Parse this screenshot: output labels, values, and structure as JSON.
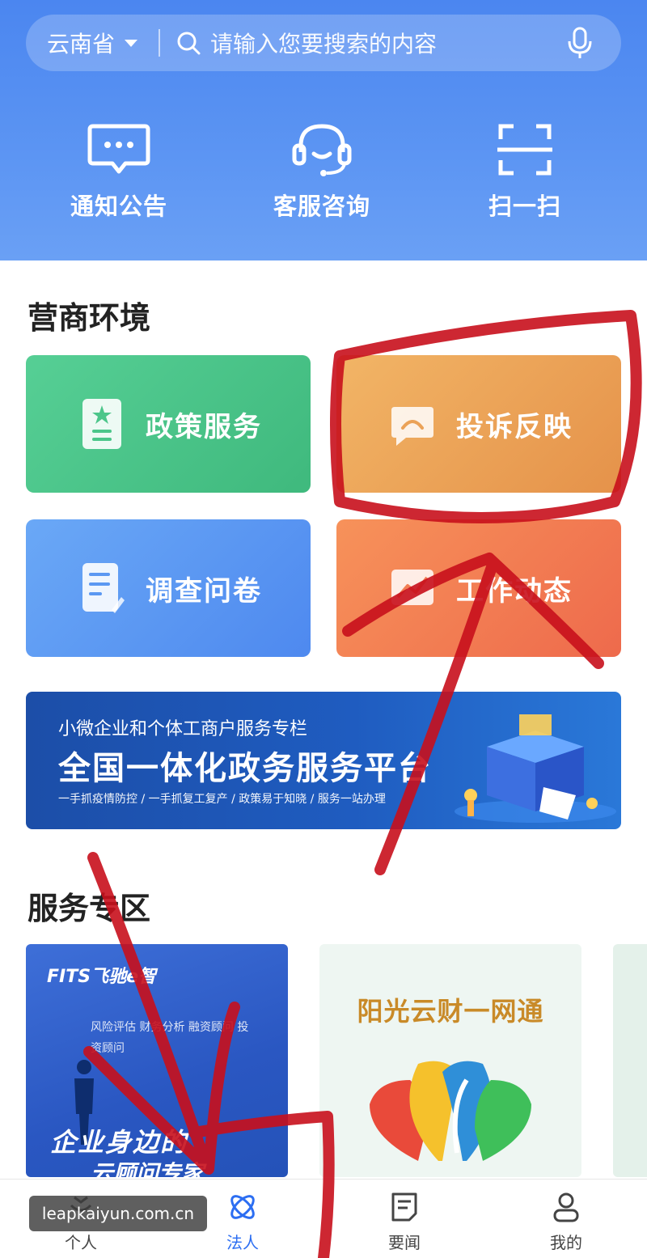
{
  "search": {
    "region": "云南省",
    "placeholder": "请输入您要搜索的内容"
  },
  "quick_actions": [
    {
      "label": "通知公告",
      "icon": "message-icon"
    },
    {
      "label": "客服咨询",
      "icon": "headset-icon"
    },
    {
      "label": "扫一扫",
      "icon": "scan-icon"
    }
  ],
  "business": {
    "title": "营商环境",
    "cards": [
      {
        "label": "政策服务",
        "icon": "policy-doc-icon",
        "color": "#4cc68a"
      },
      {
        "label": "投诉反映",
        "icon": "chat-bubble-icon",
        "color": "#eba257"
      },
      {
        "label": "调查问卷",
        "icon": "questionnaire-icon",
        "color": "#5b98f2"
      },
      {
        "label": "工作动态",
        "icon": "trend-chart-icon",
        "color": "#f27d53"
      }
    ]
  },
  "banner": {
    "subtitle": "小微企业和个体工商户服务专栏",
    "title": "全国一体化政务服务平台",
    "tagline": "一手抓疫情防控 / 一手抓复工复产 / 政策易于知晓 / 服务一站办理"
  },
  "services": {
    "title": "服务专区",
    "items": [
      {
        "logo": "FITS飞驰e智",
        "words": "风险评估 财务分析 融资顾问 投资顾问",
        "line1": "企业身边的",
        "line2": "云顾问专家"
      },
      {
        "title": "阳光云财一网通"
      }
    ]
  },
  "tabs": [
    {
      "label": "个人",
      "active": false
    },
    {
      "label": "法人",
      "active": true
    },
    {
      "label": "要闻",
      "active": false
    },
    {
      "label": "我的",
      "active": false
    }
  ],
  "watermark": "leapkaiyun.com.cn",
  "colors": {
    "primary": "#2c6ef2",
    "header": "#5890f2",
    "annotation": "#c8101c"
  }
}
